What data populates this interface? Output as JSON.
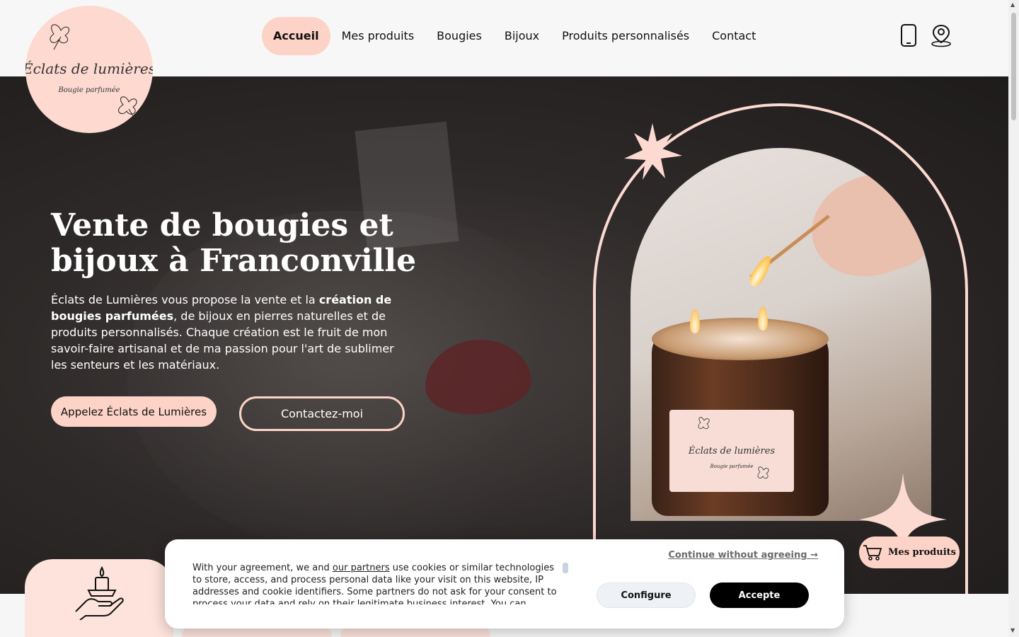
{
  "nav": {
    "items": [
      {
        "label": "Accueil",
        "active": true
      },
      {
        "label": "Mes produits"
      },
      {
        "label": "Bougies"
      },
      {
        "label": "Bijoux"
      },
      {
        "label": "Produits personnalisés"
      },
      {
        "label": "Contact"
      }
    ],
    "icons": [
      "phone-icon",
      "location-pin-icon"
    ]
  },
  "logo": {
    "title": "Éclats de lumières",
    "subtitle": "Bougie parfumée"
  },
  "hero": {
    "title": "Vente de bougies et bijoux à Franconville",
    "desc_part1": "Éclats de Lumières vous propose la vente et la ",
    "desc_bold1": "création de bougies parfumées",
    "desc_part2": ", de bijoux en pierres naturelles et de produits personnalisés. Chaque création est le fruit de mon savoir-faire artisanal et de ma passion pour l'art de sublimer les senteurs et les matériaux.",
    "btn_call": "Appelez Éclats de Lumières",
    "btn_contact": "Contactez-moi"
  },
  "cart": {
    "label": "Mes produits",
    "icon": "cart-icon"
  },
  "cookie": {
    "continue": "Continue without agreeing →",
    "text_part1": "With your agreement, we and ",
    "link": "our partners",
    "text_part2": " use cookies or similar technologies to store, access, and process personal data like your visit on this website, IP addresses and cookie identifiers. Some partners do not ask for your consent to process your data and rely on their legitimate business interest. You can",
    "configure": "Configure",
    "accept": "Accepte"
  },
  "colors": {
    "accent": "#fdd3c7",
    "hero_bg": "#2e2a29",
    "accept_btn": "#000000"
  }
}
